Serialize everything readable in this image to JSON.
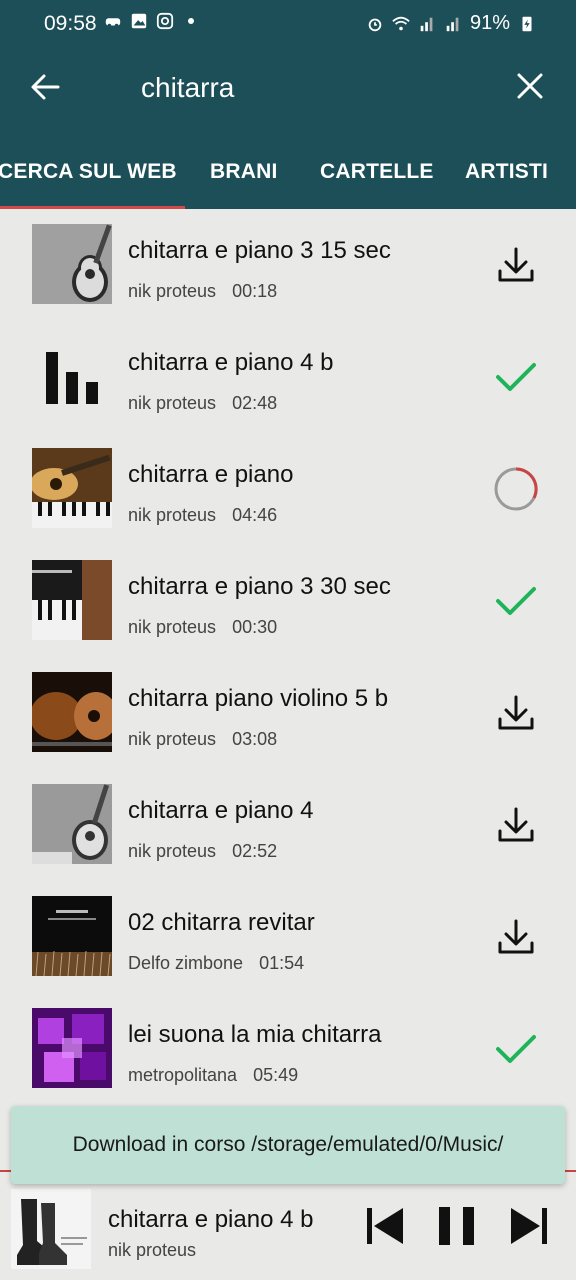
{
  "status_bar": {
    "time": "09:58",
    "battery": "91%"
  },
  "search": {
    "query": "chitarra"
  },
  "tabs": [
    {
      "label": "CERCA SUL WEB",
      "active": true
    },
    {
      "label": "BRANI",
      "active": false
    },
    {
      "label": "CARTELLE",
      "active": false
    },
    {
      "label": "ARTISTI",
      "active": false
    }
  ],
  "results": [
    {
      "title": "chitarra e piano 3 15 sec",
      "artist": "nik proteus",
      "duration": "00:18",
      "state": "download-icon"
    },
    {
      "title": "chitarra e piano 4 b",
      "artist": "nik proteus",
      "duration": "02:48",
      "state": "check-icon"
    },
    {
      "title": "chitarra e piano",
      "artist": "nik proteus",
      "duration": "04:46",
      "state": "progress-spinner-icon"
    },
    {
      "title": "chitarra e piano 3 30 sec",
      "artist": "nik proteus",
      "duration": "00:30",
      "state": "check-icon"
    },
    {
      "title": "chitarra piano violino 5 b",
      "artist": "nik proteus",
      "duration": "03:08",
      "state": "download-icon"
    },
    {
      "title": "chitarra e piano 4",
      "artist": "nik proteus",
      "duration": "02:52",
      "state": "download-icon"
    },
    {
      "title": "02 chitarra revitar",
      "artist": "Delfo zimbone",
      "duration": "01:54",
      "state": "download-icon"
    },
    {
      "title": "lei suona la mia chitarra",
      "artist": "metropolitana",
      "duration": "05:49",
      "state": "check-icon"
    }
  ],
  "toast": {
    "message": "Download in corso /storage/emulated/0/Music/"
  },
  "player": {
    "title": "chitarra e piano 4 b",
    "artist": "nik proteus"
  },
  "colors": {
    "header": "#1c4f57",
    "tab_indicator": "#d44a4a",
    "check": "#1fb45a",
    "toast": "#bfe0d4"
  }
}
